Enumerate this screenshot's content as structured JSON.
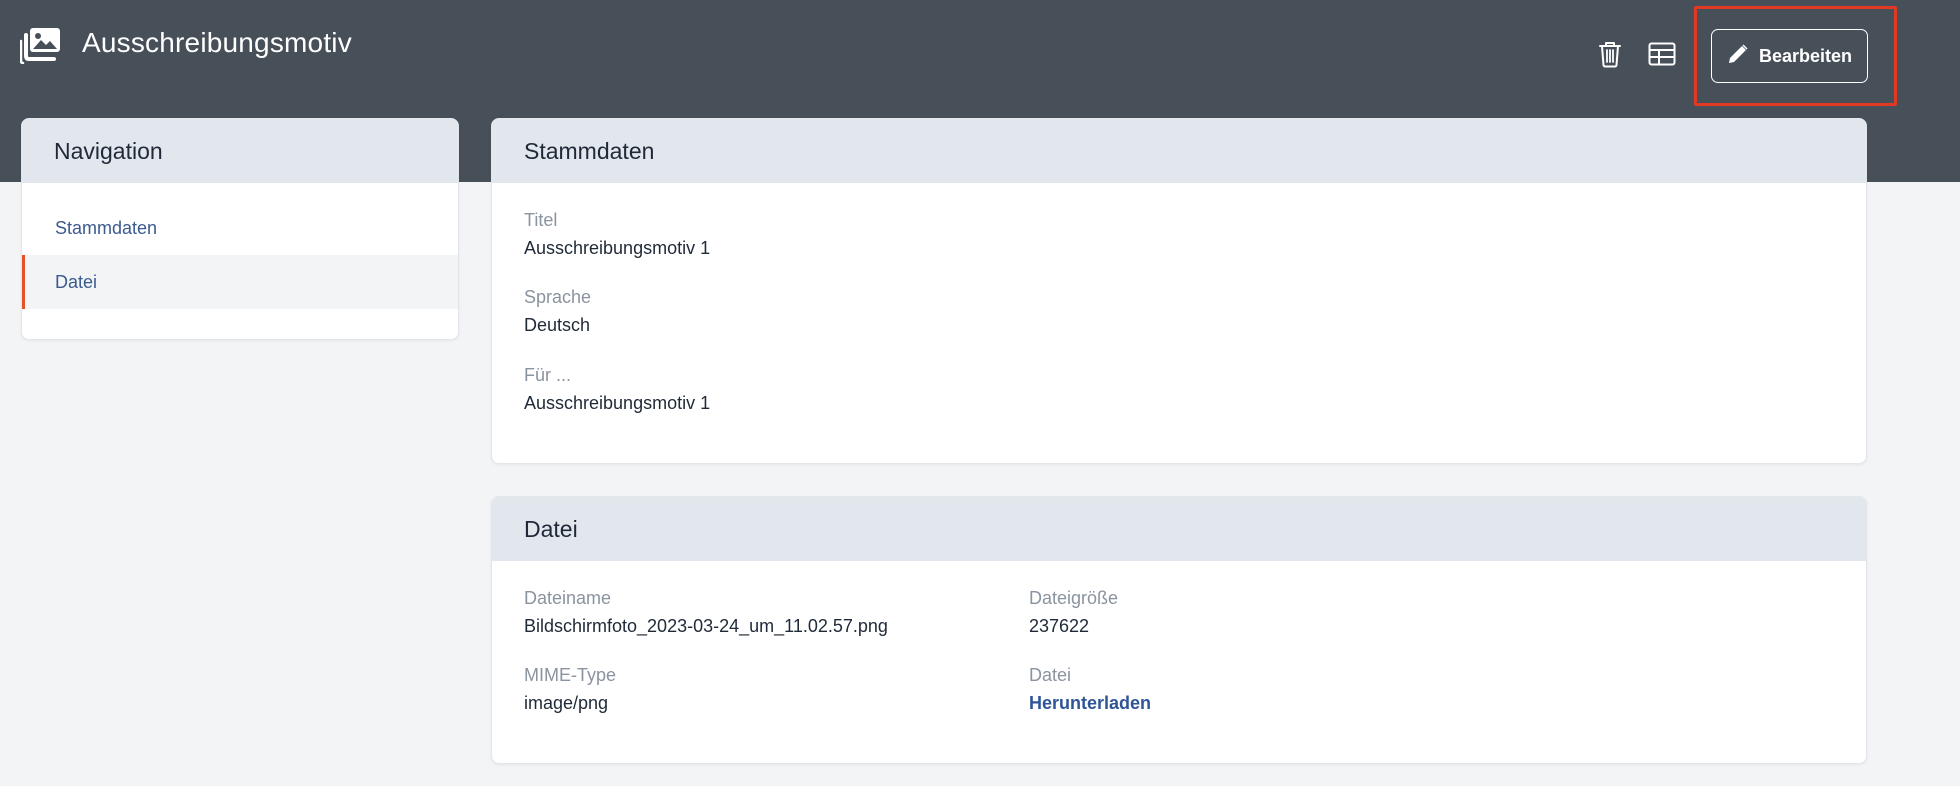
{
  "header": {
    "title": "Ausschreibungsmotiv",
    "edit_label": "Bearbeiten",
    "icons": {
      "app": "images-icon",
      "delete": "trash-icon",
      "table": "table-icon",
      "edit": "pencil-icon"
    },
    "colors": {
      "header_bg": "#474f59",
      "highlight": "#e03a25"
    }
  },
  "navigation": {
    "title": "Navigation",
    "items": [
      {
        "label": "Stammdaten",
        "active": false
      },
      {
        "label": "Datei",
        "active": true
      }
    ],
    "accent": "#e2532a"
  },
  "stammdaten": {
    "title": "Stammdaten",
    "fields": [
      {
        "label": "Titel",
        "value": "Ausschreibungsmotiv 1"
      },
      {
        "label": "Sprache",
        "value": "Deutsch"
      },
      {
        "label": "Für ...",
        "value": "Ausschreibungsmotiv 1"
      }
    ]
  },
  "datei": {
    "title": "Datei",
    "dateiname_label": "Dateiname",
    "dateiname_value": "Bildschirmfoto_2023-03-24_um_11.02.57.png",
    "groesse_label": "Dateigröße",
    "groesse_value": "237622",
    "mime_label": "MIME-Type",
    "mime_value": "image/png",
    "datei_label": "Datei",
    "download_label": "Herunterladen"
  }
}
